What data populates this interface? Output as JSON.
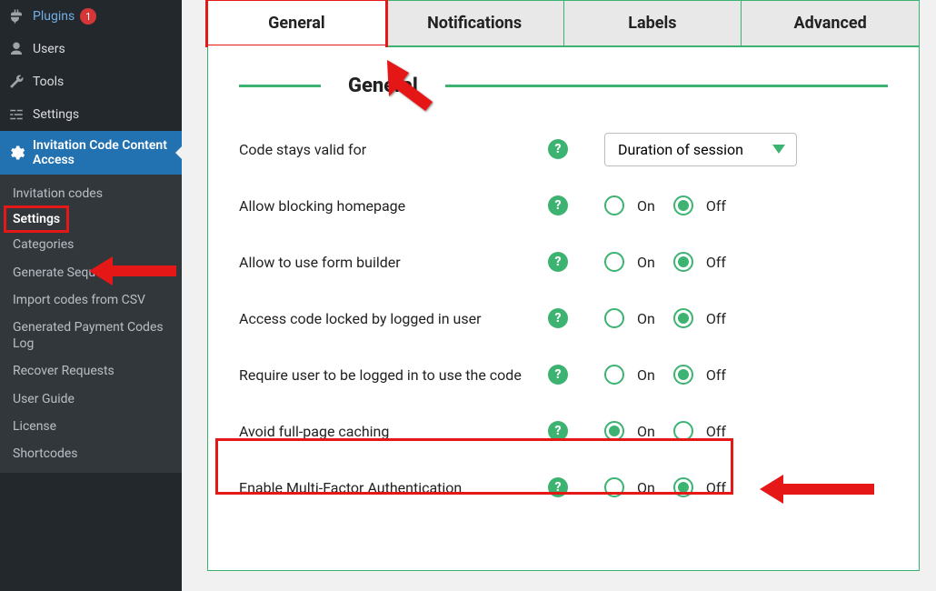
{
  "sidebar": {
    "plugins": {
      "label": "Plugins",
      "badge": "1"
    },
    "users": {
      "label": "Users"
    },
    "tools": {
      "label": "Tools"
    },
    "settings": {
      "label": "Settings"
    },
    "icca": {
      "label": "Invitation Code Content Access"
    },
    "submenu": {
      "invitation_codes": "Invitation codes",
      "settings": "Settings",
      "categories": "Categories",
      "generate_sequence": "Generate Sequence codes",
      "import_csv": "Import codes from CSV",
      "payment_log": "Generated Payment Codes Log",
      "recover_requests": "Recover Requests",
      "user_guide": "User Guide",
      "license": "License",
      "shortcodes": "Shortcodes"
    }
  },
  "tabs": {
    "general": "General",
    "notifications": "Notifications",
    "labels": "Labels",
    "advanced": "Advanced"
  },
  "section": {
    "title": "General"
  },
  "rows": {
    "valid_for": {
      "label": "Code stays valid for",
      "select_value": "Duration of session"
    },
    "block_home": {
      "label": "Allow blocking homepage",
      "on": "On",
      "off": "Off"
    },
    "form_builder": {
      "label": "Allow to use form builder",
      "on": "On",
      "off": "Off"
    },
    "locked_by_user": {
      "label": "Access code locked by logged in user",
      "on": "On",
      "off": "Off"
    },
    "require_logged": {
      "label": "Require user to be logged in to use the code",
      "on": "On",
      "off": "Off"
    },
    "avoid_cache": {
      "label": "Avoid full-page caching",
      "on": "On",
      "off": "Off"
    },
    "mfa": {
      "label": "Enable Multi-Factor Authentication",
      "on": "On",
      "off": "Off"
    }
  },
  "labels": {
    "help": "?"
  }
}
